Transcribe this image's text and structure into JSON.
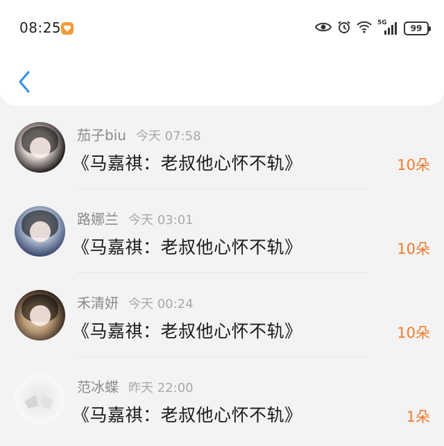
{
  "status_bar": {
    "time": "08:25",
    "network": "5G",
    "battery": "99",
    "icons": [
      "eye-icon",
      "alarm-icon",
      "wifi-icon",
      "signal-icon",
      "battery-icon"
    ]
  },
  "nav": {
    "back_icon": "chevron-left-icon"
  },
  "colors": {
    "accent_blue": "#2f8fe8",
    "amount_orange": "#f07a2b",
    "name_gray": "#8a8a8a"
  },
  "items": [
    {
      "name": "茄子biu",
      "time": "今天 07:58",
      "title": "《马嘉祺：老叔他心怀不轨》",
      "amount": "10朵"
    },
    {
      "name": "路娜兰",
      "time": "今天 03:01",
      "title": "《马嘉祺：老叔他心怀不轨》",
      "amount": "10朵"
    },
    {
      "name": "禾清妍",
      "time": "今天 00:24",
      "title": "《马嘉祺：老叔他心怀不轨》",
      "amount": "10朵"
    },
    {
      "name": "范冰蝶",
      "time": "昨天 22:00",
      "title": "《马嘉祺：老叔他心怀不轨》",
      "amount": "1朵"
    }
  ]
}
